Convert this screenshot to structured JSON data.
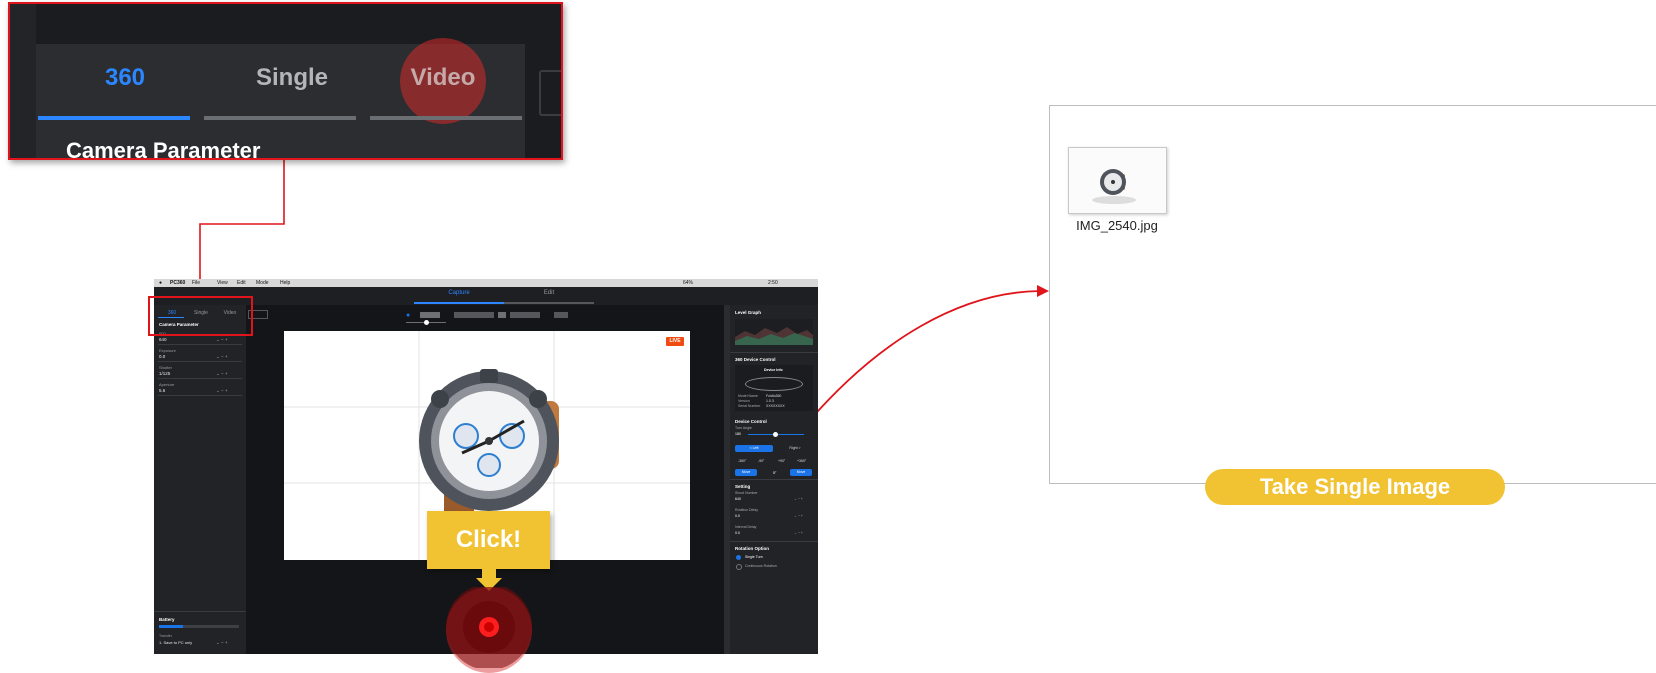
{
  "zoom": {
    "tabs": [
      {
        "label": "360",
        "active": true
      },
      {
        "label": "Single",
        "active": false
      },
      {
        "label": "Video",
        "active": false
      }
    ],
    "section_title": "Camera Parameter"
  },
  "app": {
    "menubar": {
      "app_name": "PC360",
      "menus": [
        "File",
        "View",
        "Edit",
        "Mode",
        "Help"
      ],
      "status": "64%",
      "clock": "2:50"
    },
    "mode_tabs": [
      {
        "label": "Capture",
        "active": true
      },
      {
        "label": "Edit",
        "active": false
      }
    ],
    "left_tabs": [
      "360",
      "Single",
      "Video"
    ],
    "camera_parameter_title": "Camera Parameter",
    "params": [
      {
        "label": "ISO",
        "value": "640"
      },
      {
        "label": "Exposure",
        "value": "0.0"
      },
      {
        "label": "Shutter",
        "value": "1/125"
      },
      {
        "label": "Aperture",
        "value": "5.6"
      }
    ],
    "battery_title": "Battery",
    "battery_level": 0.3,
    "transfer_label": "Transfer",
    "transfer_value": "1. Save to PC only",
    "live_badge": "LIVE",
    "right": {
      "level_graph": "Level Graph",
      "device_control_title": "360 Device Control",
      "device_info": "Device Info",
      "info_rows": [
        {
          "k": "Model Name",
          "v": "Foldio360"
        },
        {
          "k": "Version",
          "v": "1.0.3"
        },
        {
          "k": "Serial Number",
          "v": "XXXXXXXX"
        }
      ],
      "device_control": "Device Control",
      "turn_angle": "Turn Angle",
      "angle_value": "180",
      "left_btn": "< Left",
      "right_btn": "Right >",
      "presets": [
        "-360°",
        "-90°",
        "+90°",
        "+360°"
      ],
      "move_left": "Move",
      "move_right": "Move",
      "step": "5°",
      "setting_title": "Setting",
      "setting_rows": [
        {
          "label": "Shoot Number",
          "value": "640"
        },
        {
          "label": "Rotation Delay",
          "value": "0.0"
        },
        {
          "label": "Interval Delay",
          "value": "0.0"
        }
      ],
      "rotation_title": "Rotation Option",
      "rotation_options": [
        {
          "label": "Single Turn",
          "selected": true
        },
        {
          "label": "Continuous Rotation",
          "selected": false
        }
      ]
    }
  },
  "click_label": "Click!",
  "folder": {
    "file_name": "IMG_2540.jpg"
  },
  "take_button": "Take Single Image",
  "colors": {
    "highlight_red": "#e0151b",
    "accent_blue": "#1a74e8",
    "callout_yellow": "#f1c232",
    "live_orange": "#f04b11"
  }
}
